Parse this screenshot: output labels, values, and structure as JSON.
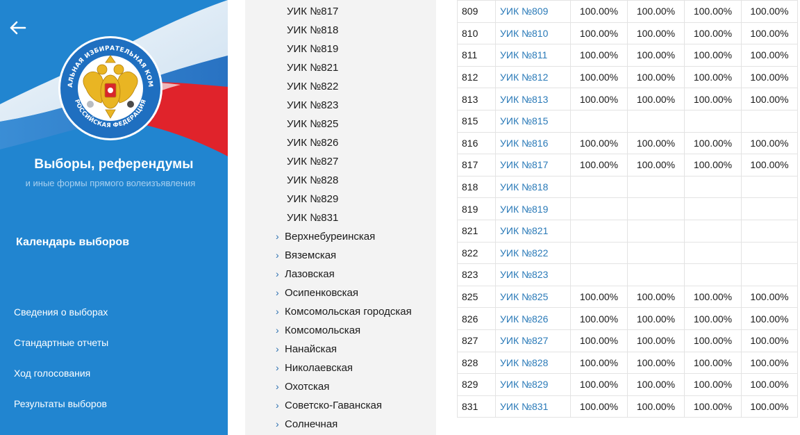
{
  "colors": {
    "sidebar_bg": "#2185d0",
    "link": "#2a7ab8",
    "tree_bg": "#f3f3f3",
    "flag_red": "#e0232b",
    "flag_white": "#ffffff",
    "emblem_gold": "#e9b523"
  },
  "sidebar": {
    "back_icon": "arrow-left-icon",
    "emblem_text": "ЦЕНТРАЛЬНАЯ ИЗБИРАТЕЛЬНАЯ КОМИССИЯ РОССИЙСКАЯ ФЕДЕРАЦИЯ",
    "title": "Выборы, референдумы",
    "subtitle": "и иные формы прямого волеизъявления",
    "calendar": "Календарь выборов",
    "nav": [
      "Сведения о выборах",
      "Стандартные отчеты",
      "Ход голосования",
      "Результаты выборов"
    ]
  },
  "tree": {
    "uiks": [
      "УИК №817",
      "УИК №818",
      "УИК №819",
      "УИК №821",
      "УИК №822",
      "УИК №823",
      "УИК №825",
      "УИК №826",
      "УИК №827",
      "УИК №828",
      "УИК №829",
      "УИК №831"
    ],
    "regions": [
      "Верхнебуреинская",
      "Вяземская",
      "Лазовская",
      "Осипенковская",
      "Комсомольская городская",
      "Комсомольская",
      "Нанайская",
      "Николаевская",
      "Охотская",
      "Советско-Гаванская",
      "Солнечная"
    ]
  },
  "table": {
    "rows": [
      {
        "num": "809",
        "name": "УИК №809",
        "v": [
          "100.00%",
          "100.00%",
          "100.00%",
          "100.00%"
        ]
      },
      {
        "num": "810",
        "name": "УИК №810",
        "v": [
          "100.00%",
          "100.00%",
          "100.00%",
          "100.00%"
        ]
      },
      {
        "num": "811",
        "name": "УИК №811",
        "v": [
          "100.00%",
          "100.00%",
          "100.00%",
          "100.00%"
        ]
      },
      {
        "num": "812",
        "name": "УИК №812",
        "v": [
          "100.00%",
          "100.00%",
          "100.00%",
          "100.00%"
        ]
      },
      {
        "num": "813",
        "name": "УИК №813",
        "v": [
          "100.00%",
          "100.00%",
          "100.00%",
          "100.00%"
        ]
      },
      {
        "num": "815",
        "name": "УИК №815",
        "v": [
          "",
          "",
          "",
          ""
        ]
      },
      {
        "num": "816",
        "name": "УИК №816",
        "v": [
          "100.00%",
          "100.00%",
          "100.00%",
          "100.00%"
        ]
      },
      {
        "num": "817",
        "name": "УИК №817",
        "v": [
          "100.00%",
          "100.00%",
          "100.00%",
          "100.00%"
        ]
      },
      {
        "num": "818",
        "name": "УИК №818",
        "v": [
          "",
          "",
          "",
          ""
        ]
      },
      {
        "num": "819",
        "name": "УИК №819",
        "v": [
          "",
          "",
          "",
          ""
        ]
      },
      {
        "num": "821",
        "name": "УИК №821",
        "v": [
          "",
          "",
          "",
          ""
        ]
      },
      {
        "num": "822",
        "name": "УИК №822",
        "v": [
          "",
          "",
          "",
          ""
        ]
      },
      {
        "num": "823",
        "name": "УИК №823",
        "v": [
          "",
          "",
          "",
          ""
        ]
      },
      {
        "num": "825",
        "name": "УИК №825",
        "v": [
          "100.00%",
          "100.00%",
          "100.00%",
          "100.00%"
        ]
      },
      {
        "num": "826",
        "name": "УИК №826",
        "v": [
          "100.00%",
          "100.00%",
          "100.00%",
          "100.00%"
        ]
      },
      {
        "num": "827",
        "name": "УИК №827",
        "v": [
          "100.00%",
          "100.00%",
          "100.00%",
          "100.00%"
        ]
      },
      {
        "num": "828",
        "name": "УИК №828",
        "v": [
          "100.00%",
          "100.00%",
          "100.00%",
          "100.00%"
        ]
      },
      {
        "num": "829",
        "name": "УИК №829",
        "v": [
          "100.00%",
          "100.00%",
          "100.00%",
          "100.00%"
        ]
      },
      {
        "num": "831",
        "name": "УИК №831",
        "v": [
          "100.00%",
          "100.00%",
          "100.00%",
          "100.00%"
        ]
      }
    ]
  }
}
